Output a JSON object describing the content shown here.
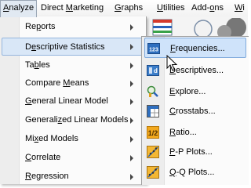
{
  "menubar": {
    "items": [
      {
        "pre": "",
        "u": "A",
        "post": "nalyze"
      },
      {
        "pre": "Direct ",
        "u": "M",
        "post": "arketing"
      },
      {
        "pre": "",
        "u": "G",
        "post": "raphs"
      },
      {
        "pre": "",
        "u": "U",
        "post": "tilities"
      },
      {
        "pre": "Add-",
        "u": "o",
        "post": "ns"
      },
      {
        "pre": "",
        "u": "W",
        "post": "i"
      }
    ]
  },
  "analyze_menu": {
    "items": [
      {
        "pre": "Re",
        "u": "p",
        "post": "orts"
      },
      {
        "pre": "D",
        "u": "e",
        "post": "scriptive Statistics"
      },
      {
        "pre": "Ta",
        "u": "b",
        "post": "les"
      },
      {
        "pre": "Compare ",
        "u": "M",
        "post": "eans"
      },
      {
        "pre": "",
        "u": "G",
        "post": "eneral Linear Model"
      },
      {
        "pre": "Generali",
        "u": "z",
        "post": "ed Linear Models"
      },
      {
        "pre": "Mi",
        "u": "x",
        "post": "ed Models"
      },
      {
        "pre": "",
        "u": "C",
        "post": "orrelate"
      },
      {
        "pre": "",
        "u": "R",
        "post": "egression"
      }
    ]
  },
  "descriptive_submenu": {
    "items": [
      {
        "pre": "",
        "u": "F",
        "post": "requencies...",
        "icon": "frequencies-icon"
      },
      {
        "pre": "",
        "u": "D",
        "post": "escriptives...",
        "icon": "descriptives-icon"
      },
      {
        "pre": "",
        "u": "E",
        "post": "xplore...",
        "icon": "explore-icon"
      },
      {
        "pre": "",
        "u": "C",
        "post": "rosstabs...",
        "icon": "crosstabs-icon"
      },
      {
        "pre": "",
        "u": "R",
        "post": "atio...",
        "icon": "ratio-icon"
      },
      {
        "pre": "",
        "u": "P",
        "post": "-P Plots...",
        "icon": "pp-plots-icon"
      },
      {
        "pre": "",
        "u": "Q",
        "post": "-Q Plots...",
        "icon": "qq-plots-icon"
      }
    ]
  },
  "colors": {
    "highlight": "#d9e7f7",
    "highlight_border": "#96b6de",
    "accent_blue": "#2a62b8"
  }
}
